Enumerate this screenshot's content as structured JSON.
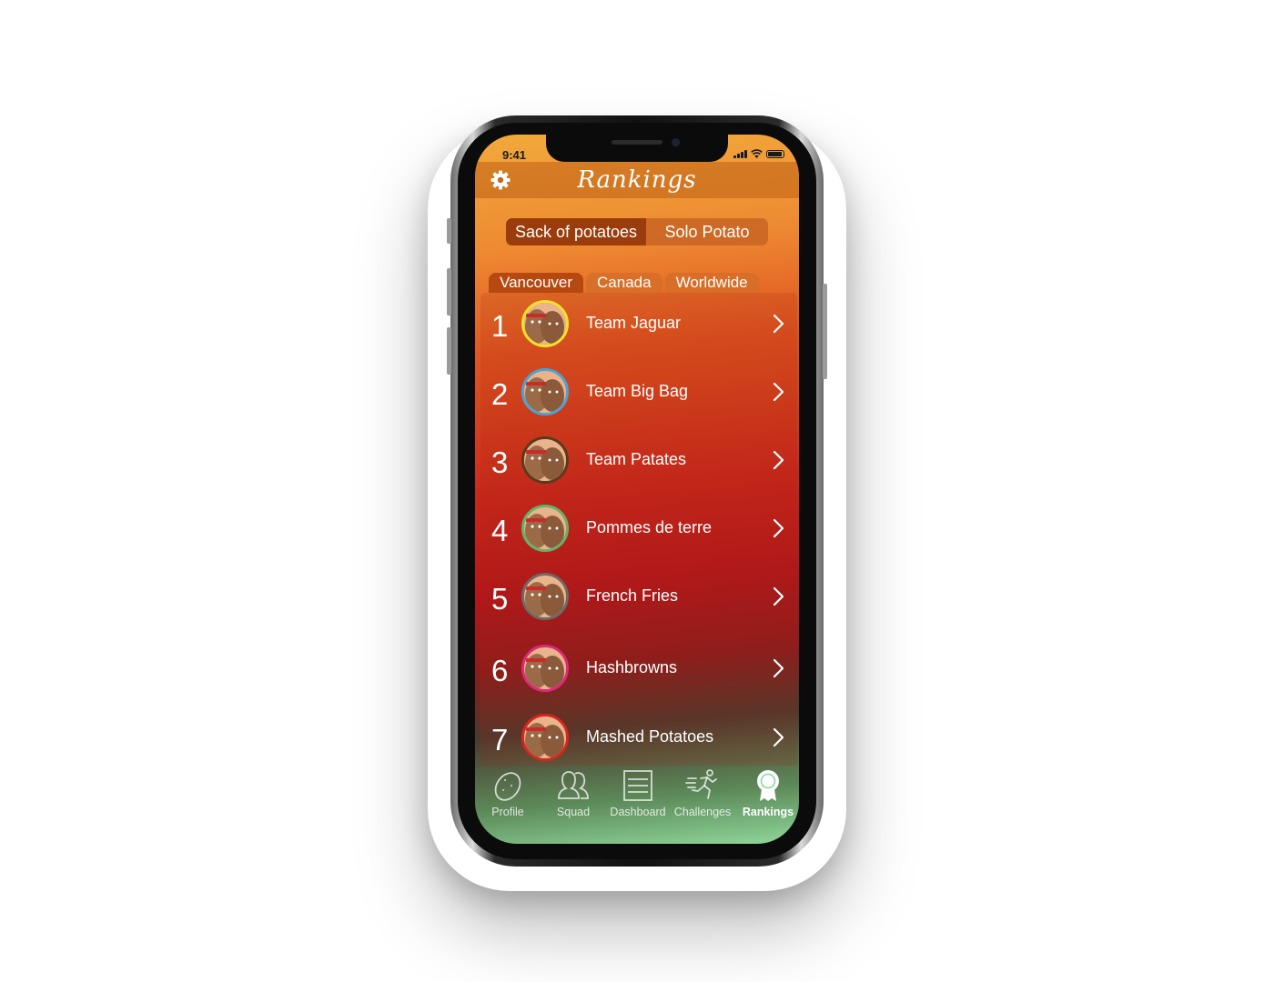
{
  "status_bar": {
    "time": "9:41"
  },
  "header": {
    "title": "Rankings",
    "settings_icon": "gear-icon"
  },
  "segment": {
    "options": [
      "Sack of potatoes",
      "Solo Potato"
    ],
    "selected": "Sack of potatoes"
  },
  "location_tabs": {
    "options": [
      "Vancouver",
      "Canada",
      "Worldwide"
    ],
    "selected": "Vancouver"
  },
  "rankings": [
    {
      "rank": "1",
      "name": "Team Jaguar",
      "ring_color": "#f5e12a",
      "avatar_icon": "potato-avatar-icon"
    },
    {
      "rank": "2",
      "name": "Team Big Bag",
      "ring_color": "#4aa3d8",
      "avatar_icon": "potato-avatar-icon"
    },
    {
      "rank": "3",
      "name": "Team Patates",
      "ring_color": "#5a3a1c",
      "avatar_icon": "potato-avatar-icon"
    },
    {
      "rank": "4",
      "name": "Pommes de terre",
      "ring_color": "#5fb56a",
      "avatar_icon": "potato-avatar-icon"
    },
    {
      "rank": "5",
      "name": "French Fries",
      "ring_color": "#6a6a6a",
      "avatar_icon": "potato-avatar-icon"
    },
    {
      "rank": "6",
      "name": "Hashbrowns",
      "ring_color": "#e0287a",
      "avatar_icon": "potato-avatar-icon"
    },
    {
      "rank": "7",
      "name": "Mashed Potatoes",
      "ring_color": "#d8251e",
      "avatar_icon": "potato-avatar-icon"
    }
  ],
  "tab_bar": {
    "items": [
      {
        "label": "Profile",
        "icon": "potato-icon"
      },
      {
        "label": "Squad",
        "icon": "squad-icon"
      },
      {
        "label": "Dashboard",
        "icon": "dashboard-icon"
      },
      {
        "label": "Challenges",
        "icon": "runner-icon"
      },
      {
        "label": "Rankings",
        "icon": "ribbon-icon"
      }
    ],
    "selected": "Rankings"
  },
  "colors": {
    "header_bg": "#be5f14",
    "segment_active": "#96370a",
    "text": "#ffffff"
  }
}
